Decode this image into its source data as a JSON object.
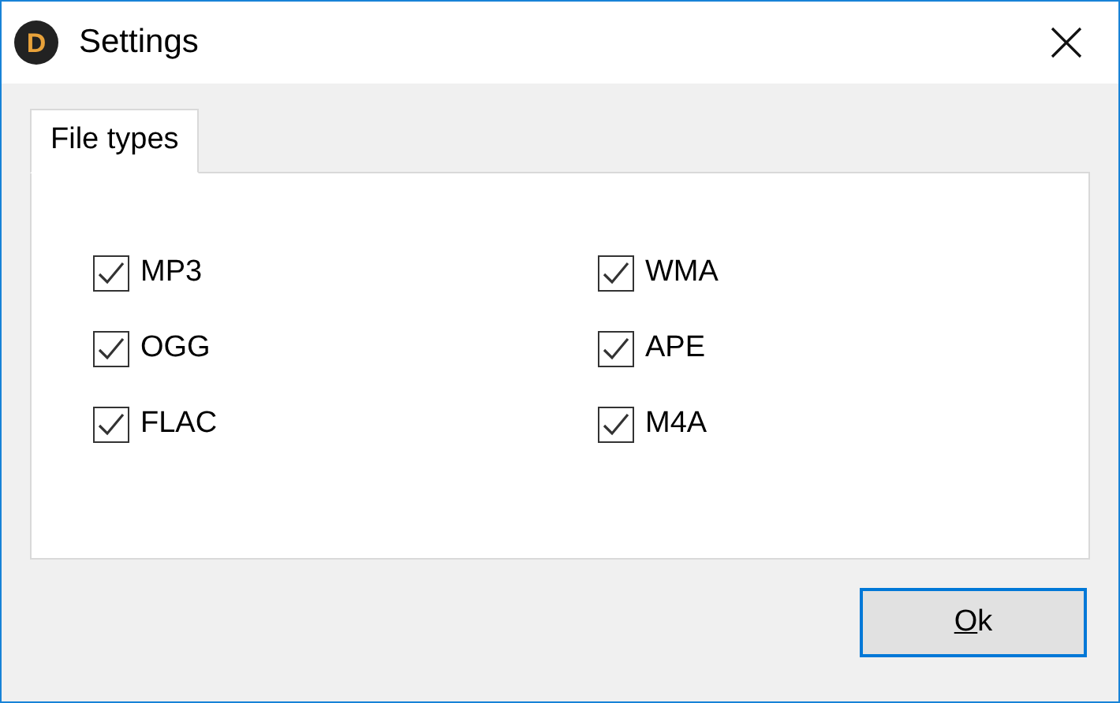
{
  "window": {
    "title": "Settings",
    "icon_letter": "D"
  },
  "tabs": [
    {
      "label": "File types",
      "selected": true
    }
  ],
  "file_types": [
    {
      "label": "MP3",
      "checked": true
    },
    {
      "label": "WMA",
      "checked": true
    },
    {
      "label": "OGG",
      "checked": true
    },
    {
      "label": "APE",
      "checked": true
    },
    {
      "label": "FLAC",
      "checked": true
    },
    {
      "label": "M4A",
      "checked": true
    }
  ],
  "buttons": [
    {
      "label": "Ok",
      "default": true
    }
  ]
}
